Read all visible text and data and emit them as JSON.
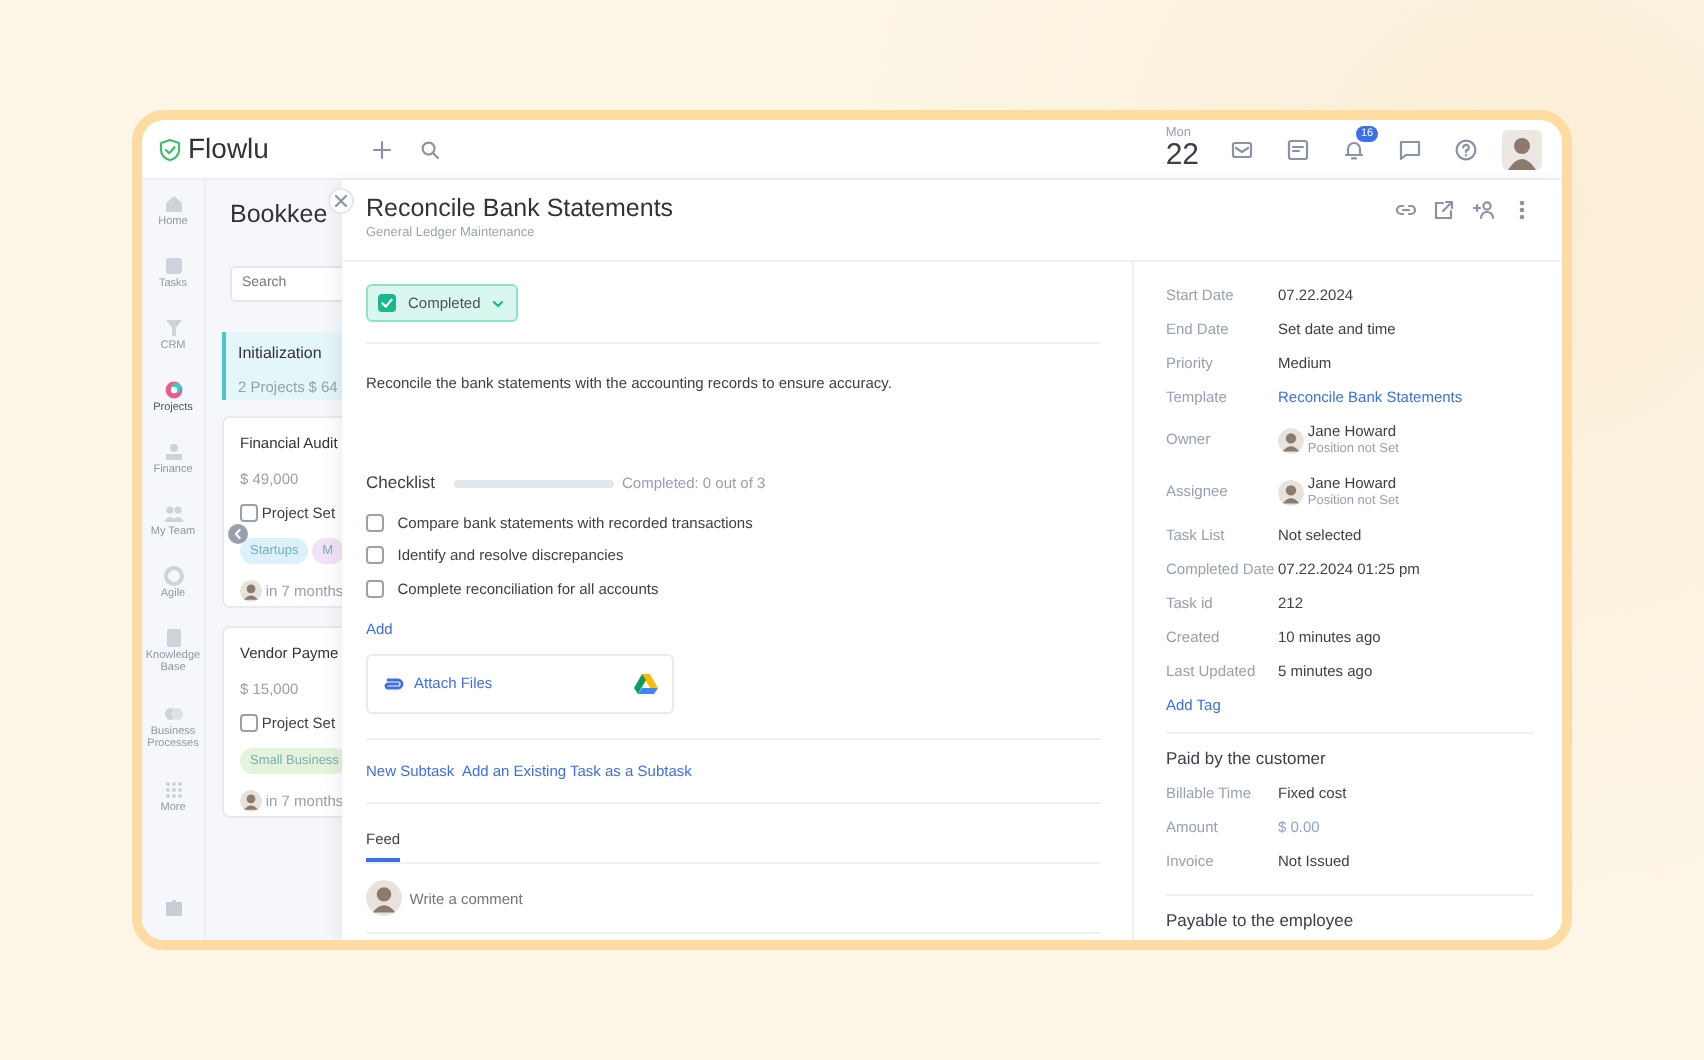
{
  "app": {
    "logo": "Flowlu"
  },
  "topbar": {
    "day": "Mon",
    "date": "22",
    "notification_count": "16"
  },
  "sidebar": {
    "items": [
      {
        "label": "Home",
        "selected": false
      },
      {
        "label": "Tasks",
        "selected": false
      },
      {
        "label": "CRM",
        "selected": false
      },
      {
        "label": "Projects",
        "selected": true
      },
      {
        "label": "Finance",
        "selected": false
      },
      {
        "label": "My Team",
        "selected": false
      },
      {
        "label": "Agile",
        "selected": false
      },
      {
        "label": "Knowledge Base",
        "selected": false
      },
      {
        "label": "Business Processes",
        "selected": false
      },
      {
        "label": "More",
        "selected": false
      }
    ]
  },
  "board": {
    "title": "Bookkee",
    "search": {
      "placeholder": "Search"
    },
    "column": {
      "title": "Initialization",
      "count": "2 Projects",
      "total": "$ 64"
    },
    "cards": [
      {
        "title": "Financial Audit",
        "amount": "$ 49,000",
        "stage": "Project Set",
        "checked": false,
        "tags": [
          {
            "label": "Startups",
            "color": "#dcf1fa"
          },
          {
            "label": "M",
            "color": "#f1e2f8"
          }
        ],
        "due": "in 7 months"
      },
      {
        "title": "Vendor Payme",
        "amount": "$ 15,000",
        "stage": "Project Set",
        "checked": false,
        "tags": [
          {
            "label": "Small Business",
            "color": "#e4f3db"
          }
        ],
        "due": "in 7 months"
      }
    ]
  },
  "task": {
    "title": "Reconcile Bank Statements",
    "subtitle": "General Ledger Maintenance",
    "status": {
      "label": "Completed",
      "checked": true
    },
    "description": "Reconcile the bank statements with the accounting records to ensure accuracy.",
    "checklist": {
      "title": "Checklist",
      "level": 0,
      "progress_text": "Completed: 0 out of 3",
      "add": "Add",
      "items": [
        {
          "label": "Compare bank statements with recorded transactions",
          "checked": false
        },
        {
          "label": "Identify and resolve discrepancies",
          "checked": false
        },
        {
          "label": "Complete reconciliation for all accounts",
          "checked": false
        }
      ]
    },
    "attach": "Attach Files",
    "subtask_links": [
      "New Subtask",
      "Add an Existing Task as a Subtask"
    ],
    "tabs": [
      {
        "label": "Feed",
        "selected": true
      }
    ],
    "comment": {
      "placeholder": "Write a comment"
    }
  },
  "details": {
    "fields": [
      {
        "kind": "text",
        "label": "Start Date",
        "value": "07.22.2024"
      },
      {
        "kind": "text",
        "label": "End Date",
        "value": "Set date and time"
      },
      {
        "kind": "text",
        "label": "Priority",
        "value": "Medium"
      },
      {
        "kind": "link",
        "label": "Template",
        "value": "Reconcile Bank Statements"
      },
      {
        "kind": "person",
        "label": "Owner",
        "value": "Jane Howard",
        "note": "Position not Set"
      },
      {
        "kind": "person",
        "label": "Assignee",
        "value": "Jane Howard",
        "note": "Position not Set"
      },
      {
        "kind": "text",
        "label": "Task List",
        "value": "Not selected"
      },
      {
        "kind": "text",
        "label": "Completed Date",
        "value": "07.22.2024 01:25 pm"
      },
      {
        "kind": "text",
        "label": "Task id",
        "value": "212"
      },
      {
        "kind": "text",
        "label": "Created",
        "value": "10 minutes ago"
      },
      {
        "kind": "text",
        "label": "Last Updated",
        "value": "5 minutes ago"
      }
    ],
    "add_tag": "Add Tag",
    "sections": [
      {
        "title": "Paid by the customer",
        "fields": [
          {
            "kind": "text",
            "label": "Billable Time",
            "value": "Fixed cost"
          },
          {
            "kind": "muted",
            "label": "Amount",
            "value": "$ 0.00"
          },
          {
            "kind": "text",
            "label": "Invoice",
            "value": "Not Issued"
          }
        ]
      },
      {
        "title": "Payable to the employee"
      }
    ]
  }
}
